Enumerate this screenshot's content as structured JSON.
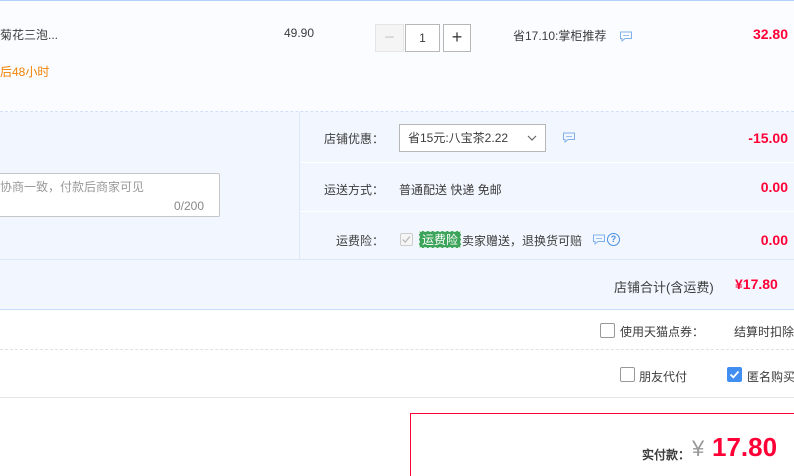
{
  "item": {
    "title": "菊花三泡...",
    "promise": "后48小时",
    "unit_price": "49.90",
    "quantity": "1",
    "qty_minus": "−",
    "qty_plus": "+",
    "discount": "省17.10:掌柜推荐",
    "subtotal": "32.80"
  },
  "message": {
    "placeholder": "协商一致，付款后商家可见",
    "count": "0/200"
  },
  "shop_coupon": {
    "label": "店铺优惠：",
    "selected": "省15元:八宝茶2.22",
    "amount": "-15.00"
  },
  "shipping": {
    "label": "运送方式：",
    "value": "普通配送 快递 免邮",
    "amount": "0.00"
  },
  "insurance": {
    "label": "运费险：",
    "badge": "运费险",
    "text": "卖家赠送，退换货可赔",
    "amount": "0.00",
    "help": "?"
  },
  "shop_total": {
    "label": "店铺合计(含运费)",
    "amount": "¥17.80"
  },
  "tmall_points": {
    "label": "使用天猫点券：",
    "note": "结算时扣除"
  },
  "friend_pay": {
    "label": "朋友代付"
  },
  "anonymous": {
    "label": "匿名购买",
    "checked": true
  },
  "payment": {
    "label": "实付款：",
    "currency": "¥",
    "amount": "17.80"
  },
  "colors": {
    "accent_red": "#ff0036",
    "link_blue": "#3f8ef0",
    "badge_green": "#3ca35a",
    "panel_bg": "#f2f7ff"
  },
  "icons": [
    "chat-bubble-icon",
    "chevron-down-icon",
    "help-icon",
    "check-icon"
  ]
}
